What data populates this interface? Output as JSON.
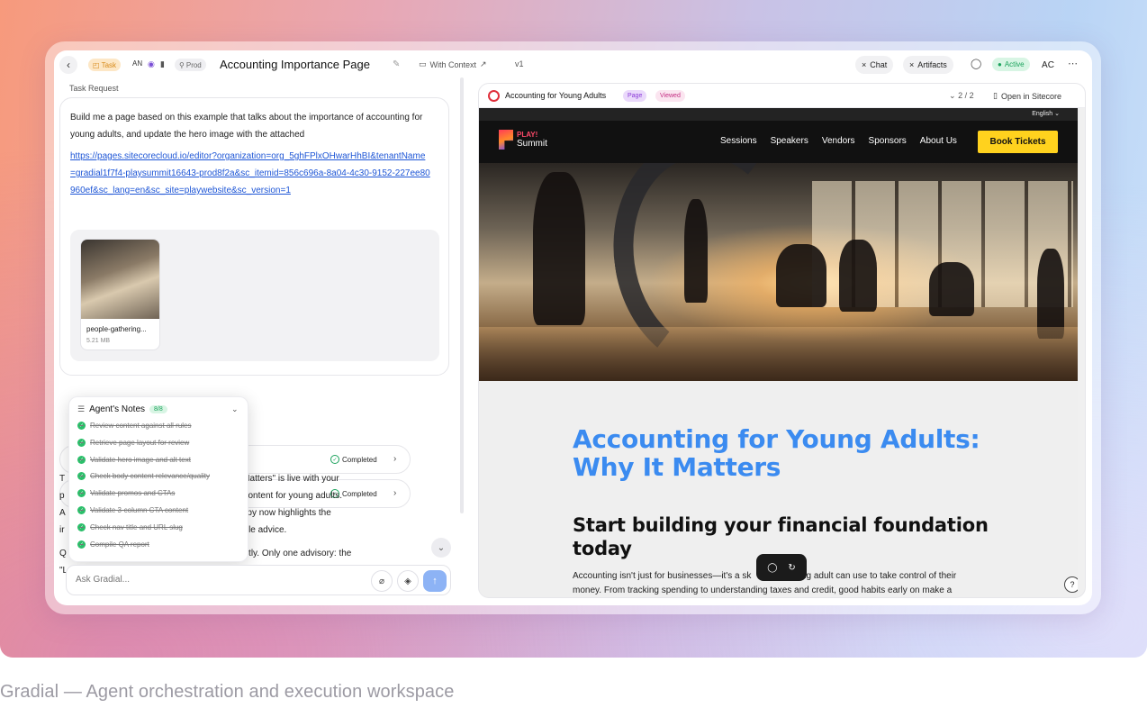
{
  "caption": "Gradial — Agent orchestration and execution workspace",
  "topbar": {
    "task_label": "Task",
    "user_initials": "AN",
    "env_label": "Prod",
    "page_title": "Accounting Importance Page",
    "context_label": "With Context",
    "version": "v1",
    "chat_label": "Chat",
    "artifacts_label": "Artifacts",
    "status_label": "Active",
    "avatar_initials": "AC"
  },
  "left": {
    "task_request_label": "Task Request",
    "request_text": "Build me a page based on this example that talks about the importance of accounting for young adults, and update the hero image with the attached",
    "request_link": "https://pages.sitecorecloud.io/editor?organization=org_5ghFPlxOHwarHhBI&tenantName=gradial1f7f4-playsummit16643-prod8f2a&sc_itemid=856c696a-8a04-4c30-9152-227ee80960ef&sc_lang=en&sc_site=playwebsite&sc_version=1",
    "attachment": {
      "name": "people-gathering...",
      "size": "5.21 MB"
    },
    "steps": [
      {
        "status": "Completed"
      },
      {
        "status": "Completed"
      }
    ],
    "result_lines": [
      "T                                                        s: Why It Matters\" is live with your",
      "p                                                        d custom content for young adults.",
      "A                                                        and the copy now highlights the",
      "ir                                                        e, actionable advice.",
      "",
      "Q                                                        ads correctly. Only one advisory: the",
      "\"L"
    ],
    "notes": {
      "title": "Agent's Notes",
      "count": "8/8",
      "items": [
        "Review content against all rules",
        "Retrieve page layout for review",
        "Validate hero image and alt text",
        "Check body content relevance/quality",
        "Validate promos and CTAs",
        "Validate 3-column CTA content",
        "Check nav title and URL slug",
        "Compile QA report"
      ]
    },
    "ask_placeholder": "Ask Gradial..."
  },
  "preview": {
    "title": "Accounting for Young Adults",
    "badge_page": "Page",
    "badge_viewed": "Viewed",
    "count": "2 / 2",
    "open_label": "Open in Sitecore",
    "site": {
      "language": "English",
      "brand_top": "PLAY!",
      "brand_bottom": "Summit",
      "nav": [
        "Sessions",
        "Speakers",
        "Vendors",
        "Sponsors",
        "About Us"
      ],
      "cta": "Book Tickets",
      "h1": "Accounting for Young Adults: Why It Matters",
      "h2": "Start building your financial foundation today",
      "body": "Accounting isn't just for businesses—it's a sk                  ung adult can use to take control of their money. From tracking spending to understanding taxes and credit, good habits early on make a"
    }
  }
}
